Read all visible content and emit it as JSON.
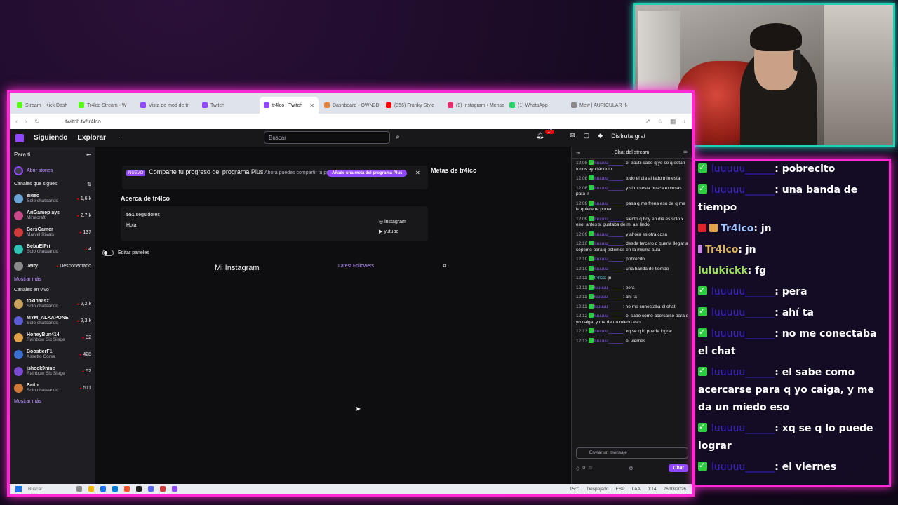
{
  "browser": {
    "tabs": [
      {
        "label": "Stream - Kick Dash",
        "color": "#53fc18"
      },
      {
        "label": "Tr4lco Stream - W",
        "color": "#53fc18"
      },
      {
        "label": "Vista de mod de tr",
        "color": "#9147ff"
      },
      {
        "label": "Twitch",
        "color": "#9147ff"
      },
      {
        "label": "tr4lco - Twitch",
        "color": "#9147ff",
        "active": true
      },
      {
        "label": "Dashboard - OWN3D",
        "color": "#e8833a"
      },
      {
        "label": "(356) Franky Style",
        "color": "#ff0000"
      },
      {
        "label": "(9) Instagram • Mensa",
        "color": "#e1306c"
      },
      {
        "label": "(1) WhatsApp",
        "color": "#25d366"
      },
      {
        "label": "Mew | AURICULAR IN",
        "color": "#888888"
      }
    ],
    "url": "twitch.tv/tr4lco"
  },
  "topnav": {
    "following": "Siguiendo",
    "explore": "Explorar",
    "search_placeholder": "Buscar",
    "notif_count": "17",
    "prime": "Disfruta grat"
  },
  "sidebar": {
    "for_you": "Para ti",
    "stories": "Abrir stories",
    "followed_title": "Canales que sigues",
    "followed": [
      {
        "name": "elded",
        "game": "Solo chateando",
        "viewers": "1,6 k",
        "color": "#6aa3d8"
      },
      {
        "name": "AriGameplays",
        "game": "Minecraft",
        "viewers": "2,7 k",
        "color": "#c94a8a"
      },
      {
        "name": "BersGamer",
        "game": "Marvel Rivals",
        "viewers": "137",
        "color": "#d13a3a"
      },
      {
        "name": "BebuElPri",
        "game": "Solo chateando",
        "viewers": "4",
        "color": "#2ec4b6"
      },
      {
        "name": "Jelty",
        "game": "",
        "viewers": "Desconectado",
        "color": "#8a8a8a"
      }
    ],
    "more": "Mostrar más",
    "live_title": "Canales en vivo",
    "live": [
      {
        "name": "toxinaasz",
        "game": "Solo chateando",
        "viewers": "2,2 k",
        "color": "#c9a15a"
      },
      {
        "name": "MYM_ALKAPONE",
        "game": "Solo chateando",
        "viewers": "2,3 k",
        "color": "#5b5bd6"
      },
      {
        "name": "HoneyBun414",
        "game": "Rainbow Six Siege",
        "viewers": "32",
        "color": "#e2a24a"
      },
      {
        "name": "BoostierF1",
        "game": "Assetto Corsa",
        "viewers": "428",
        "color": "#3a6fd1"
      },
      {
        "name": "jshock9nine",
        "game": "Rainbow Six Siege",
        "viewers": "52",
        "color": "#7a4ad1"
      },
      {
        "name": "Faith",
        "game": "Solo chateando",
        "viewers": "511",
        "color": "#d17a3a"
      }
    ],
    "more2": "Mostrar más"
  },
  "main": {
    "nuevo": "NUEVO",
    "plus_title": "Comparte tu progreso del programa Plus",
    "plus_text": "Ahora puedes compartir tu progreso de Plus con tu comunidad.",
    "plus_button": "Añade una meta del programa Plus",
    "about_title": "Acerca de tr4lco",
    "followers_count": "551",
    "followers_label": "seguidores",
    "bio": "Hola",
    "link_instagram": "instagram",
    "link_youtube": "yutube",
    "goals_title": "Metas de tr4lco",
    "edit_panels": "Editar paneles",
    "panel_instagram": "Mi Instagram",
    "panel_latest": "Latest Followers"
  },
  "chat": {
    "title": "Chat del stream",
    "messages": [
      {
        "ts": "12:08",
        "user": "luuuuu______",
        "text": "el bautii sabe q yo se q estan todos ayudándolo"
      },
      {
        "ts": "12:08",
        "user": "luuuuu______",
        "text": "todo el dia al lado mio esta"
      },
      {
        "ts": "12:08",
        "user": "luuuuu______",
        "text": "y si mo esta busca excusas para ir"
      },
      {
        "ts": "12:09",
        "user": "luuuuu______",
        "text": "pasa q me frena eso de q me la quiere re poner"
      },
      {
        "ts": "12:09",
        "user": "luuuuu______",
        "text": "siento q hoy en dia es solo x eso, antes si gustaba de mi asi lindo"
      },
      {
        "ts": "12:09",
        "user": "luuuuu______",
        "text": "y ahora es otra cosa"
      },
      {
        "ts": "12:10",
        "user": "luuuuu______",
        "text": "desde tercero q quería llegar a séptimo para q estemos en la misma aula"
      },
      {
        "ts": "12:10",
        "user": "luuuuu______",
        "text": "pobrecito"
      },
      {
        "ts": "12:10",
        "user": "luuuuu______",
        "text": "una banda de tiempo"
      },
      {
        "ts": "12:11",
        "user": "tr4lco",
        "text": "jn",
        "streamer": true
      },
      {
        "ts": "12:11",
        "user": "luuuuu______",
        "text": "pera"
      },
      {
        "ts": "12:11",
        "user": "luuuuu______",
        "text": "ahí ta"
      },
      {
        "ts": "12:11",
        "user": "luuuuu______",
        "text": "no me conectaba el chat"
      },
      {
        "ts": "12:12",
        "user": "luuuuu______",
        "text": "el sabe como acercarse para q yo caiga, y me da un miedo eso"
      },
      {
        "ts": "12:13",
        "user": "luuuuu______",
        "text": "xq se q lo puede lograr"
      },
      {
        "ts": "12:13",
        "user": "luuuuu______",
        "text": "el viernes"
      }
    ],
    "input_placeholder": "Enviar un mensaje",
    "points": "0",
    "send": "Chat"
  },
  "taskbar": {
    "search": "Buscar",
    "weather": "15°C",
    "weather_desc": "Despejado",
    "lang": "ESP",
    "lang2": "LAA",
    "time": "0:14",
    "date": "26/03/2026"
  },
  "overlay_chat": {
    "messages": [
      {
        "user": "luuuuu______",
        "text": ": pobrecito",
        "style": "u"
      },
      {
        "user": "luuuuu______",
        "text": ": una banda de tiempo",
        "style": "u"
      },
      {
        "user": "Tr4lco",
        "text": ": jn",
        "style": "u-cyan",
        "badges": true
      },
      {
        "user": "Tr4lco",
        "text": ": jn",
        "style": "u-gold",
        "mic": true
      },
      {
        "user": "lulukickk",
        "text": ": fg",
        "style": "u-green"
      },
      {
        "user": "luuuuu______",
        "text": ": pera",
        "style": "u"
      },
      {
        "user": "luuuuu______",
        "text": ": ahí ta",
        "style": "u"
      },
      {
        "user": "luuuuu______",
        "text": ": no me conectaba el chat",
        "style": "u"
      },
      {
        "user": "luuuuu______",
        "text": ": el sabe como acercarse para q yo caiga, y me da un miedo eso",
        "style": "u"
      },
      {
        "user": "luuuuu______",
        "text": ": xq se q lo puede lograr",
        "style": "u"
      },
      {
        "user": "luuuuu______",
        "text": ": el viernes",
        "style": "u"
      }
    ]
  },
  "colors": {
    "twitch_purple": "#9147ff",
    "frame_pink": "#ff2ad4",
    "cam_teal": "#1ed3b5"
  }
}
